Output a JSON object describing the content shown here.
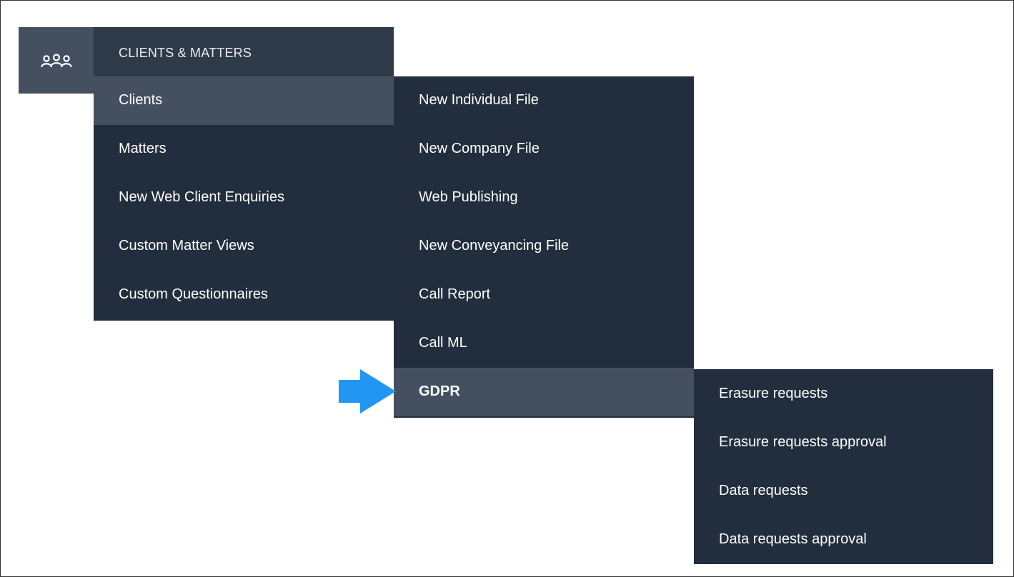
{
  "colors": {
    "icon_tab_bg": "#44505f",
    "menu_bg": "#222e3d",
    "menu_header_bg": "#2f3a49",
    "active_item_bg": "#44505f",
    "text": "#ffffff",
    "arrow": "#2196f3"
  },
  "icon_tab": {
    "icon": "people-group-icon"
  },
  "menu1": {
    "header": "CLIENTS & MATTERS",
    "items": [
      {
        "label": "Clients",
        "active": true
      },
      {
        "label": "Matters"
      },
      {
        "label": "New Web Client Enquiries"
      },
      {
        "label": "Custom  Matter Views"
      },
      {
        "label": "Custom Questionnaires"
      }
    ]
  },
  "menu2": {
    "items": [
      {
        "label": "New Individual File"
      },
      {
        "label": "New Company File"
      },
      {
        "label": "Web Publishing"
      },
      {
        "label": "New Conveyancing File"
      },
      {
        "label": "Call Report"
      },
      {
        "label": "Call ML"
      },
      {
        "label": "GDPR",
        "active": true
      }
    ]
  },
  "menu3": {
    "items": [
      {
        "label": "Erasure requests"
      },
      {
        "label": "Erasure requests approval"
      },
      {
        "label": "Data requests"
      },
      {
        "label": "Data requests approval"
      }
    ]
  },
  "annotation": {
    "icon": "arrow-right-icon"
  }
}
